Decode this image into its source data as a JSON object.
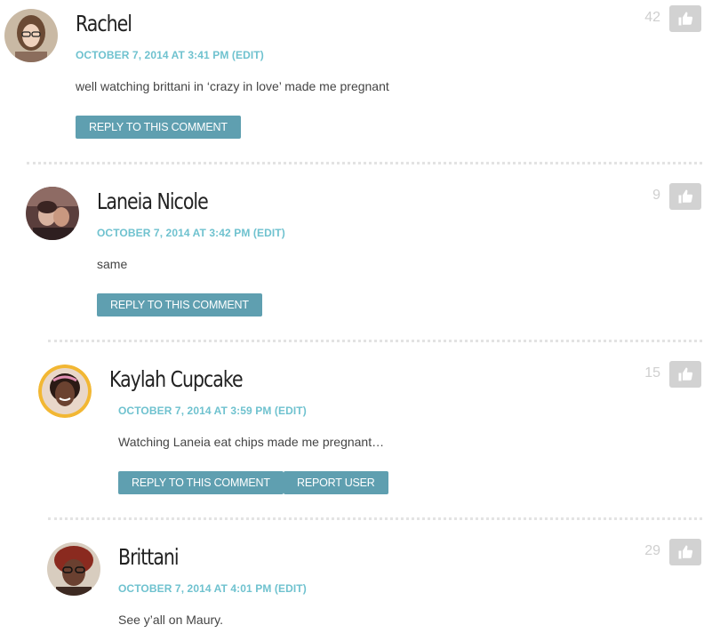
{
  "comments": [
    {
      "name": "Rachel",
      "date": "OCTOBER 7, 2014 AT 3:41 PM (EDIT)",
      "text": "well watching brittani in ‘crazy in love’ made me pregnant",
      "votes": "42",
      "reply_label": "REPLY TO THIS COMMENT"
    },
    {
      "name": "Laneia Nicole",
      "date": "OCTOBER 7, 2014 AT 3:42 PM (EDIT)",
      "text": "same",
      "votes": "9",
      "reply_label": "REPLY TO THIS COMMENT"
    },
    {
      "name": "Kaylah Cupcake",
      "date": "OCTOBER 7, 2014 AT 3:59 PM (EDIT)",
      "text": "Watching Laneia eat chips made me pregnant…",
      "votes": "15",
      "reply_label": "REPLY TO THIS COMMENT",
      "report_label": "REPORT USER"
    },
    {
      "name": "Brittani",
      "date": "OCTOBER 7, 2014 AT 4:01 PM (EDIT)",
      "text": "See y’all on Maury.",
      "votes": "29"
    }
  ],
  "colors": {
    "accent": "#6fc2cf",
    "button": "#5f9fb0",
    "like_button": "#d2d2d2"
  },
  "icons": {
    "like": "thumbs-up-icon"
  }
}
